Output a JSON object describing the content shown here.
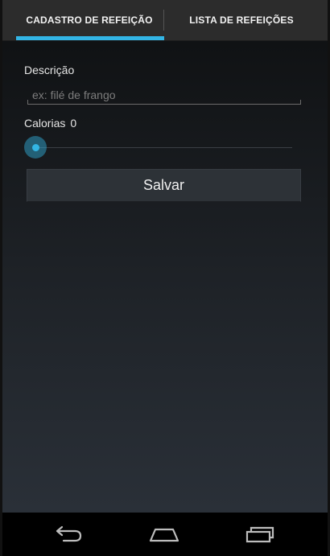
{
  "tabs": [
    {
      "label": "CADASTRO DE REFEIÇÃO",
      "selected": true
    },
    {
      "label": "LISTA DE REFEIÇÕES",
      "selected": false
    }
  ],
  "form": {
    "descricao_label": "Descrição",
    "descricao_placeholder": "ex: filé de frango",
    "descricao_value": "",
    "calorias_label": "Calorias",
    "calorias_value": "0",
    "slider_fraction": 0,
    "save_label": "Salvar"
  },
  "navbar": {
    "icons": [
      "back-icon",
      "home-icon",
      "recent-apps-icon"
    ]
  },
  "colors": {
    "accent": "#33b5e5",
    "tab_background": "#2c2c2c",
    "button_background": "#2d3237"
  }
}
